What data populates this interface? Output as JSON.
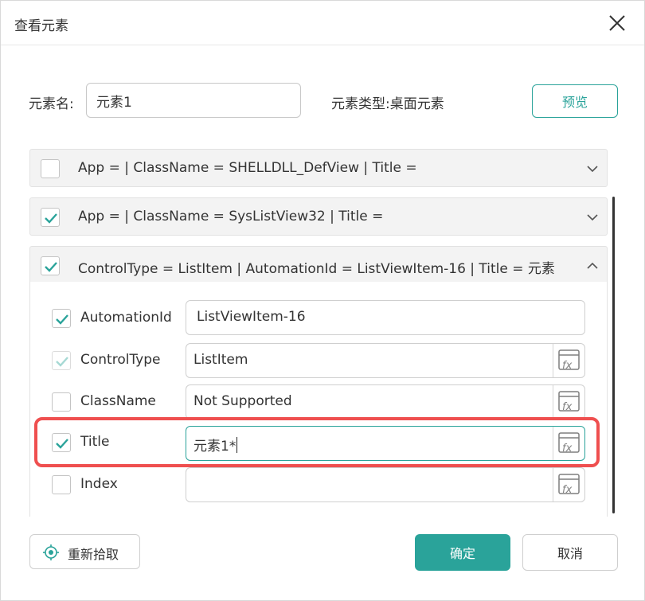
{
  "dialog": {
    "title": "查看元素",
    "close_icon": "close-icon"
  },
  "element": {
    "name_label": "元素名:",
    "name_value": "元素1",
    "type_label": "元素类型:",
    "type_value": "桌面元素",
    "preview_label": "预览"
  },
  "hierarchy": [
    {
      "checked": false,
      "text": "App =  | ClassName = SHELLDLL_DefView | Title =",
      "expanded": false
    },
    {
      "checked": true,
      "text": "App =  | ClassName = SysListView32 | Title =",
      "expanded": false
    },
    {
      "checked": true,
      "text": "ControlType = ListItem | AutomationId = ListViewItem-16 | Title = 元素",
      "expanded": true
    }
  ],
  "properties": [
    {
      "label": "AutomationId",
      "checked": true,
      "value": "ListViewItem-16",
      "has_fx": false
    },
    {
      "label": "ControlType",
      "checked": true,
      "disabled": true,
      "value": "ListItem",
      "has_fx": true
    },
    {
      "label": "ClassName",
      "checked": false,
      "value": "Not Supported",
      "has_fx": true
    },
    {
      "label": "Title",
      "checked": true,
      "value": "元素1*",
      "has_fx": true,
      "active": true
    },
    {
      "label": "Index",
      "checked": false,
      "value": "",
      "has_fx": true
    }
  ],
  "footer": {
    "repick_label": "重新拾取",
    "repick_icon": "target-icon",
    "ok_label": "确定",
    "cancel_label": "取消"
  },
  "colors": {
    "accent": "#2aa39a",
    "highlight": "#ef4f4f",
    "row_background": "#f3f3f3"
  }
}
